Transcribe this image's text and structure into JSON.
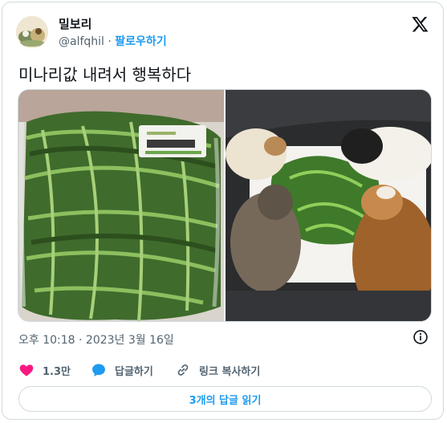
{
  "author": {
    "display_name": "밀보리",
    "handle": "@alfqhil",
    "separator": "·",
    "follow_label": "팔로우하기"
  },
  "tweet": {
    "text": "미나리값 내려서 행복하다",
    "timestamp": "오후 10:18 · 2023년 3월 16일"
  },
  "actions": {
    "like_count": "1.3만",
    "reply_label": "답글하기",
    "copy_link_label": "링크 복사하기"
  },
  "read_replies_label": "3개의 답글 읽기",
  "colors": {
    "accent": "#1d9bf0",
    "like": "#f91880",
    "secondary_text": "#536471"
  },
  "icons": [
    "x-logo-icon",
    "info-icon",
    "heart-icon",
    "reply-bubble-icon",
    "link-icon"
  ]
}
